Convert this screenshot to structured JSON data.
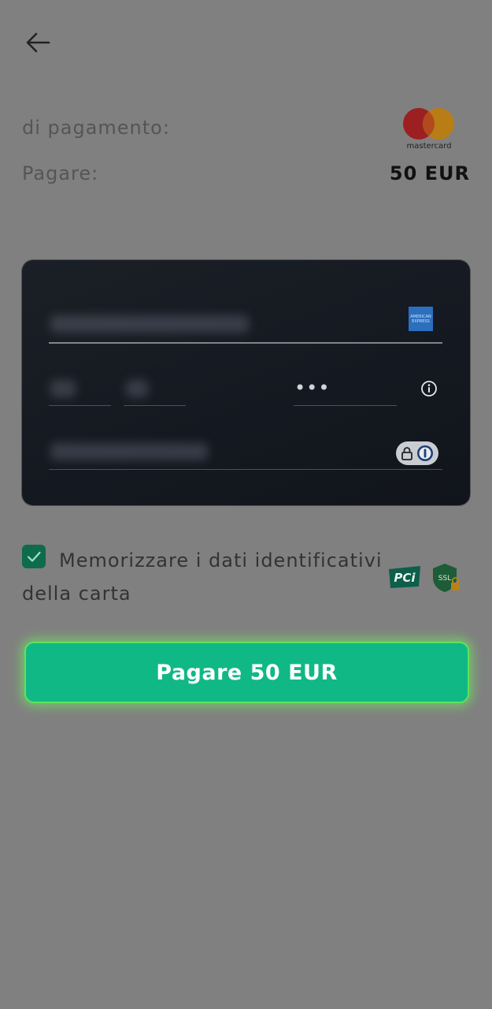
{
  "summary": {
    "method_label": "di pagamento:",
    "pay_label": "Pagare:",
    "amount": "50 EUR",
    "card_brand_logo": "mastercard",
    "card_brand_logo_text": "mastercard"
  },
  "card_form": {
    "card_number_field": "blurred",
    "network_icon": "american-express",
    "amex_text": "AMERICAN EXPRESS",
    "cvv_value": "•••",
    "info_icon": "info-icon",
    "password_manager_icon": "lock-key-icon"
  },
  "save_card": {
    "checked": true,
    "label": "Memorizzare i dati identificativi della carta"
  },
  "badges": {
    "pci": "PCi",
    "ssl": "SSL"
  },
  "pay_button": {
    "label": "Pagare 50 EUR"
  },
  "colors": {
    "background": "#808080",
    "button": "#10b886",
    "button_glow": "#5ce35a",
    "card": "#161a21",
    "checkbox": "#0e6b4d"
  }
}
